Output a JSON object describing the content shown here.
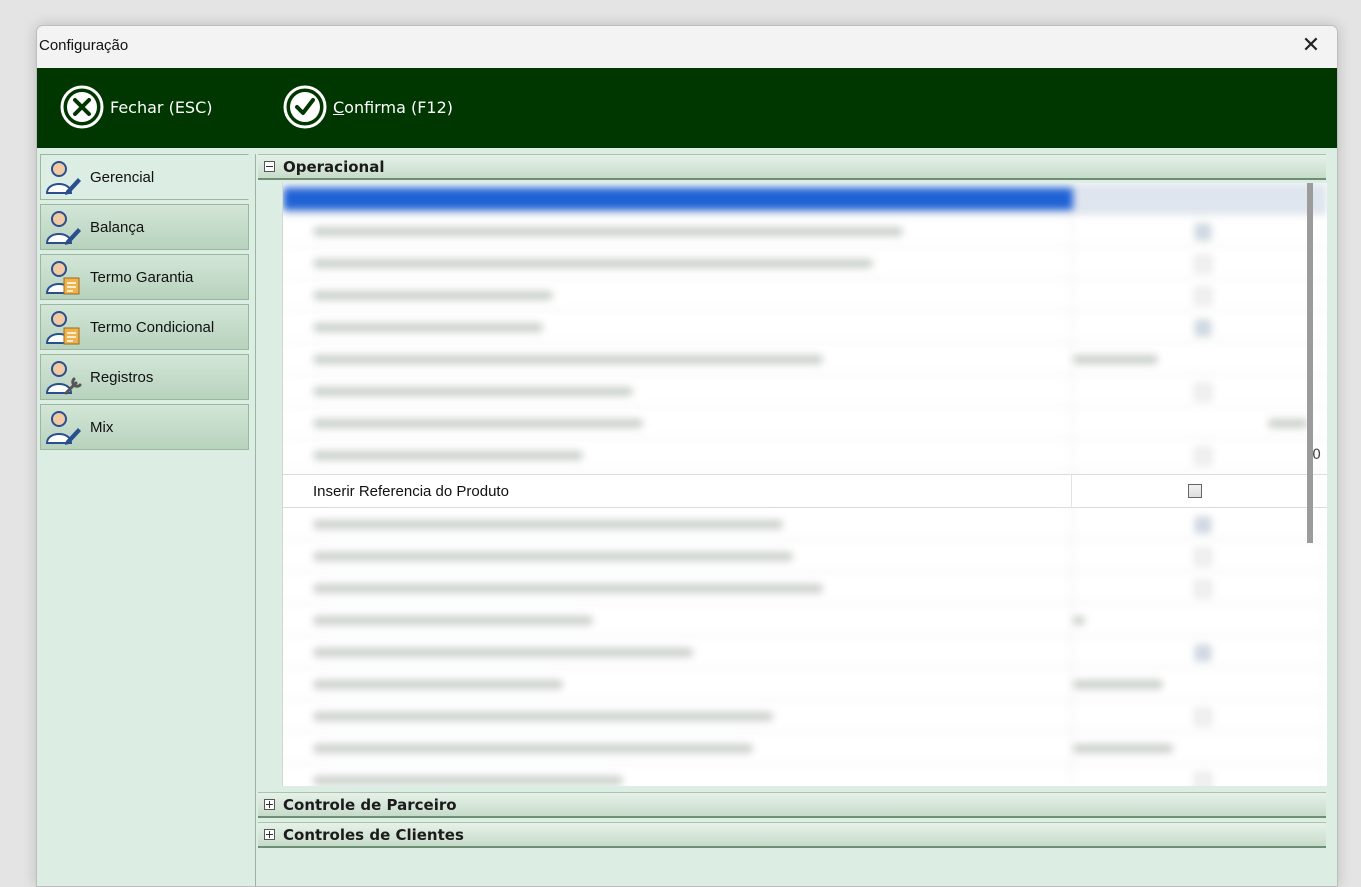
{
  "window": {
    "title": "Configuração",
    "close_glyph": "✕"
  },
  "toolbar": {
    "close_label": "Fechar (ESC)",
    "confirm_prefix": "C",
    "confirm_rest": "onfirma (F12)"
  },
  "sidebar": {
    "items": [
      {
        "label": "Gerencial",
        "icon": "user-pen-icon",
        "active": true
      },
      {
        "label": "Balança",
        "icon": "user-pen-icon"
      },
      {
        "label": "Termo Garantia",
        "icon": "user-document-icon"
      },
      {
        "label": "Termo Condicional",
        "icon": "user-document-icon"
      },
      {
        "label": "Registros",
        "icon": "user-wrench-icon"
      },
      {
        "label": "Mix",
        "icon": "user-pen-icon"
      }
    ]
  },
  "groups": [
    {
      "label": "Operacional",
      "expanded": true
    },
    {
      "label": "Controle de Parceiro",
      "expanded": false
    },
    {
      "label": "Controles de Clientes",
      "expanded": false
    }
  ],
  "visible_row": {
    "label": "Inserir Referencia do Produto",
    "checked": false
  },
  "edge_fragment": "0",
  "colors": {
    "toolbar": "#003700",
    "content_bg": "#dceee3",
    "selected": "#1f62d6"
  }
}
